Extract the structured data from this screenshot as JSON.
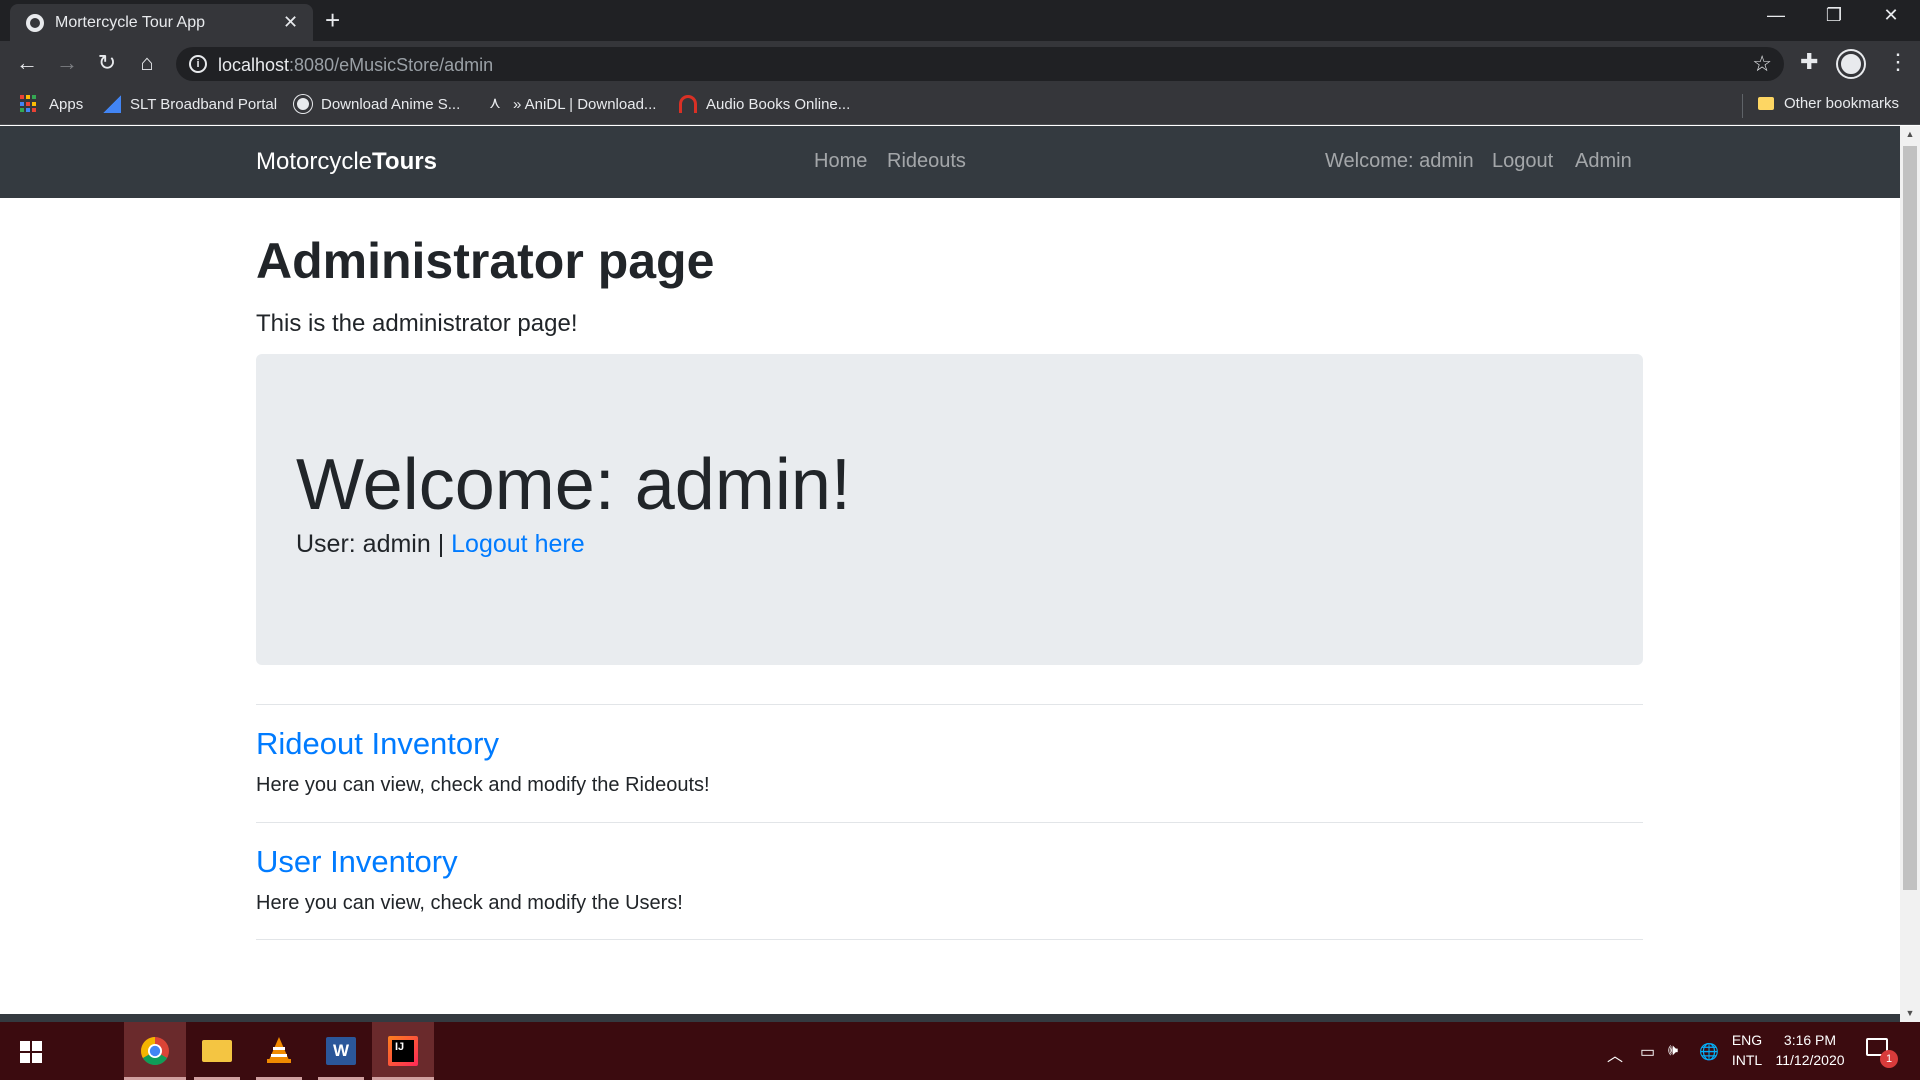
{
  "browser": {
    "tab_title": "Mortercycle Tour App",
    "url_host": "localhost",
    "url_rest": ":8080/eMusicStore/admin",
    "bookmarks": [
      {
        "label": "Apps"
      },
      {
        "label": "SLT Broadband Portal"
      },
      {
        "label": "Download Anime S..."
      },
      {
        "label": "» AniDL | Download..."
      },
      {
        "label": "Audio Books Online..."
      }
    ],
    "other_bookmarks": "Other bookmarks"
  },
  "site": {
    "brand_light": "Motorcycle",
    "brand_bold": "Tours",
    "nav": {
      "home": "Home",
      "rideouts": "Rideouts"
    },
    "nav_right": {
      "welcome": "Welcome: admin",
      "logout": "Logout",
      "admin": "Admin"
    }
  },
  "page": {
    "title": "Administrator page",
    "lead": "This is the administrator page!",
    "jumbotron": {
      "title": "Welcome: admin!",
      "user_text": "User: admin | ",
      "logout_link": "Logout here"
    },
    "sections": [
      {
        "title": "Rideout Inventory",
        "desc": "Here you can view, check and modify the Rideouts!"
      },
      {
        "title": "User Inventory",
        "desc": "Here you can view, check and modify the Users!"
      }
    ]
  },
  "taskbar": {
    "lang_top": "ENG",
    "lang_bottom": "INTL",
    "time": "3:16 PM",
    "date": "11/12/2020",
    "notification_count": "1",
    "apps": [
      "chrome-icon",
      "file-explorer-icon",
      "vlc-icon",
      "word-icon",
      "intellij-icon"
    ]
  },
  "colors": {
    "navbar": "#343a40",
    "link": "#007bff",
    "jumbotron_bg": "#e9ecef",
    "taskbar": "#3b0b0f"
  }
}
